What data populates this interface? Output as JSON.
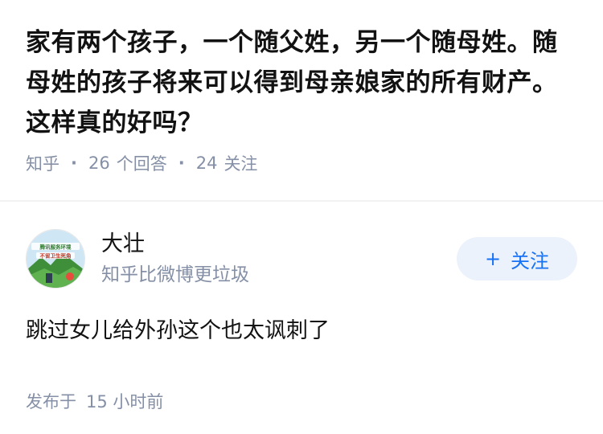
{
  "question": {
    "title": "家有两个孩子，一个随父姓，另一个随母姓。随母姓的孩子将来可以得到母亲娘家的所有财产。这样真的好吗？",
    "source": "知乎",
    "separator": "·",
    "answer_count": "26",
    "answer_label": "个回答",
    "follower_count": "24",
    "follower_label": "关注"
  },
  "answer": {
    "author": {
      "name": "大壮",
      "bio": "知乎比微博更垃圾",
      "avatar_icon": "avatar-landscape-icon",
      "avatar_banner_top": "腾讯服务环境",
      "avatar_banner_bottom": "不留卫生死角"
    },
    "follow_button": {
      "icon": "+",
      "label": "关注"
    },
    "text": "跳过女儿给外孙这个也太讽刺了",
    "time_prefix": "发布于",
    "time_value": "15 小时前"
  },
  "colors": {
    "primary_text": "#121212",
    "secondary_text": "#8590a6",
    "accent": "#1772f6",
    "accent_bg": "#ebf2fb"
  }
}
